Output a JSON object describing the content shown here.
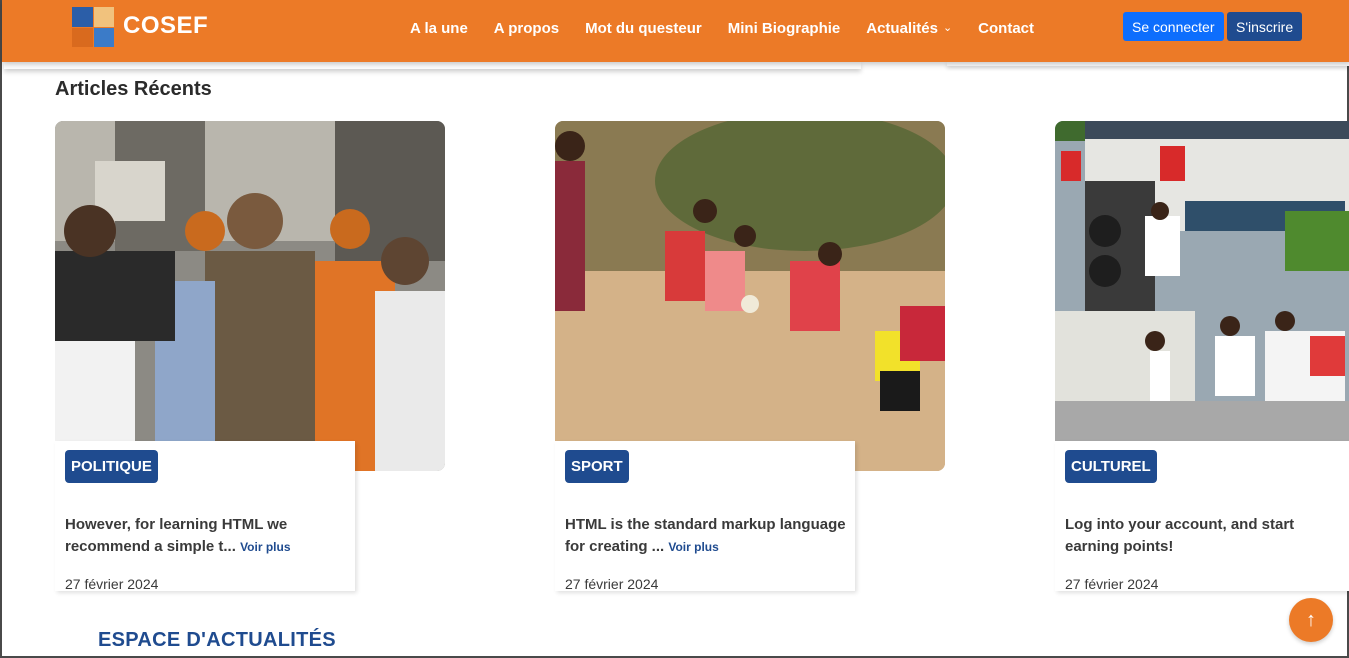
{
  "brand": {
    "name": "COSEF"
  },
  "nav": {
    "items": [
      {
        "label": "A la une"
      },
      {
        "label": "A propos"
      },
      {
        "label": "Mot du questeur"
      },
      {
        "label": "Mini Biographie"
      },
      {
        "label": "Actualités",
        "icon": "chevron-down-icon"
      },
      {
        "label": "Contact"
      }
    ],
    "login_label": "Se connecter",
    "signup_label": "S'inscrire"
  },
  "section": {
    "title": "Articles Récents"
  },
  "articles": [
    {
      "category": "POLITIQUE",
      "excerpt": "However, for learning HTML we recommend a simple t...",
      "read_more": "Voir plus",
      "date": "27 février 2024",
      "image": "press-interview-photo"
    },
    {
      "category": "SPORT",
      "excerpt": "HTML is the standard markup language for creating ...",
      "read_more": "Voir plus",
      "date": "27 février 2024",
      "image": "beach-football-photo"
    },
    {
      "category": "CULTUREL",
      "excerpt": "Log into your account, and start earning points!",
      "read_more": "",
      "date": "27 février 2024",
      "image": "street-festival-photo"
    }
  ],
  "espace": {
    "title": "ESPACE D'ACTUALITÉS"
  },
  "scroll_top": {
    "icon": "arrow-up-icon"
  },
  "colors": {
    "navbar": "#ec7a27",
    "badge": "#1f4b8f",
    "login_button": "#0d6efd",
    "signup_button": "#1f4b8f"
  }
}
